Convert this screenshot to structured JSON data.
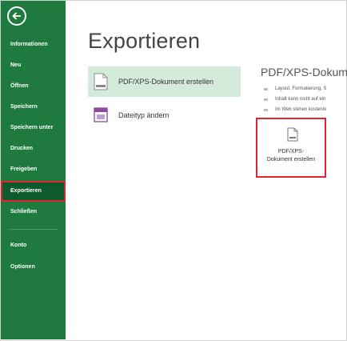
{
  "sidebar": {
    "items": [
      {
        "label": "Informationen"
      },
      {
        "label": "Neu"
      },
      {
        "label": "Öffnen"
      },
      {
        "label": "Speichern"
      },
      {
        "label": "Speichern unter"
      },
      {
        "label": "Drucken"
      },
      {
        "label": "Freigeben"
      },
      {
        "label": "Exportieren"
      },
      {
        "label": "Schließen"
      },
      {
        "label": "Konto"
      },
      {
        "label": "Optionen"
      }
    ],
    "active_item": "Exportieren",
    "back_icon": "back-arrow-icon",
    "colors": {
      "background": "#1f7a40",
      "active": "#0d5b2c",
      "highlight": "#e0262d"
    }
  },
  "main": {
    "title": "Exportieren",
    "options": [
      {
        "label": "PDF/XPS-Dokument erstellen",
        "icon": "pdf-document-icon",
        "selected": true
      },
      {
        "label": "Dateityp ändern",
        "icon": "change-filetype-icon",
        "selected": false
      }
    ]
  },
  "detail": {
    "title": "PDF/XPS-Dokum",
    "bullets": [
      "Layout, Formatierung, S",
      "Inhalt kann nicht auf ein",
      "Im Web stehen kostenlo"
    ],
    "button": {
      "line1": "PDF/XPS-",
      "line2": "Dokument erstellen",
      "icon": "pdf-document-icon"
    }
  }
}
